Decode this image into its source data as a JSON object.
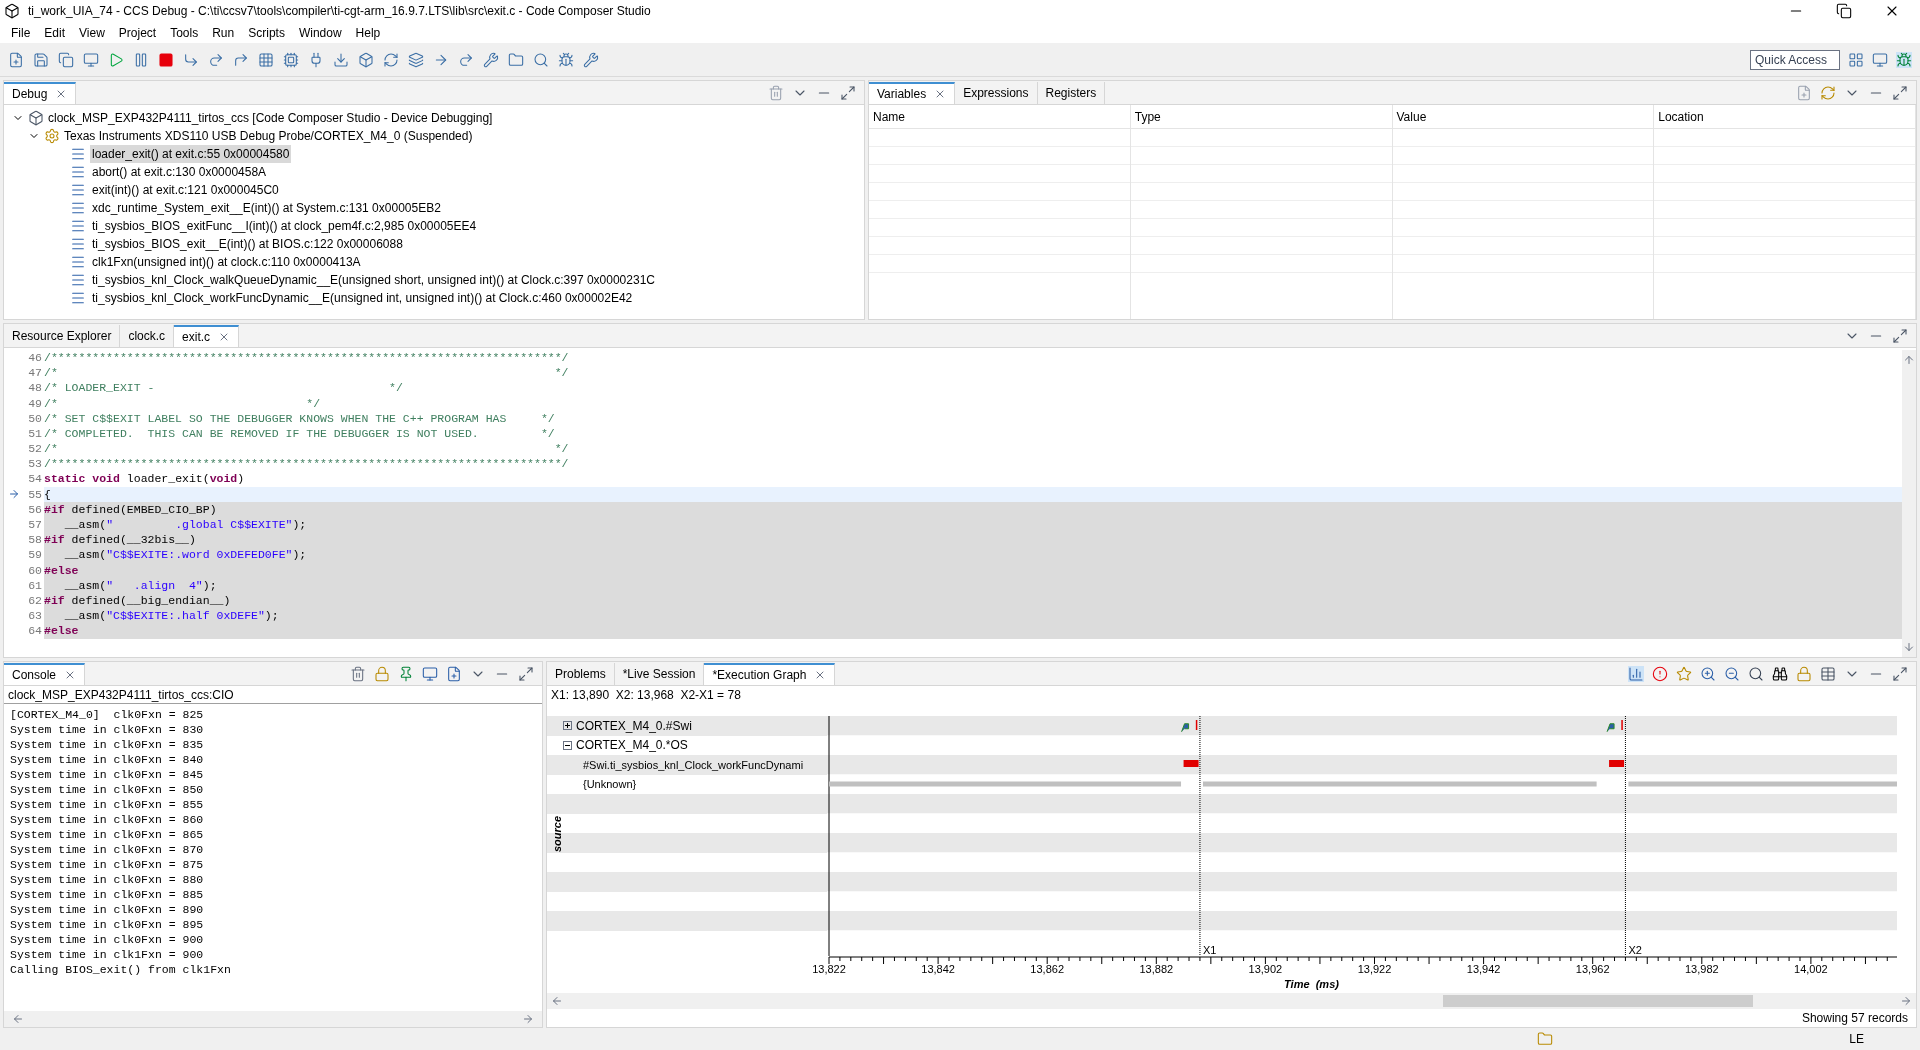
{
  "window": {
    "title": "ti_work_UIA_74 - CCS Debug - C:\\ti\\ccsv7\\tools\\compiler\\ti-cgt-arm_16.9.7.LTS\\lib\\src\\exit.c - Code Composer Studio"
  },
  "menu": [
    "File",
    "Edit",
    "View",
    "Project",
    "Tools",
    "Run",
    "Scripts",
    "Window",
    "Help"
  ],
  "quick_access": {
    "placeholder": "Quick Access"
  },
  "debug": {
    "tabs": [
      {
        "label": "Debug",
        "selected": true
      }
    ],
    "tree": [
      {
        "label": "clock_MSP_EXP432P4111_tirtos_ccs [Code Composer Studio - Device Debugging]",
        "expanded": true,
        "children": [
          {
            "label": "Texas Instruments XDS110 USB Debug Probe/CORTEX_M4_0 (Suspended)",
            "expanded": true,
            "frames": [
              {
                "label": "loader_exit() at exit.c:55 0x00004580",
                "selected": true
              },
              {
                "label": "abort() at exit.c:130 0x0000458A",
                "selected": false
              },
              {
                "label": "exit(int)() at exit.c:121 0x000045C0",
                "selected": false
              },
              {
                "label": "xdc_runtime_System_exit__E(int)() at System.c:131 0x00005EB2",
                "selected": false
              },
              {
                "label": "ti_sysbios_BIOS_exitFunc__I(int)() at clock_pem4f.c:2,985 0x00005EE4",
                "selected": false
              },
              {
                "label": "ti_sysbios_BIOS_exit__E(int)() at BIOS.c:122 0x00006088",
                "selected": false
              },
              {
                "label": "clk1Fxn(unsigned int)() at clock.c:110 0x0000413A",
                "selected": false
              },
              {
                "label": "ti_sysbios_knl_Clock_walkQueueDynamic__E(unsigned short, unsigned int)() at Clock.c:397 0x0000231C",
                "selected": false
              },
              {
                "label": "ti_sysbios_knl_Clock_workFuncDynamic__E(unsigned int, unsigned int)() at Clock.c:460 0x00002E42",
                "selected": false
              }
            ]
          }
        ]
      }
    ]
  },
  "variables": {
    "tabs": [
      {
        "label": "Variables",
        "selected": true
      },
      {
        "label": "Expressions",
        "selected": false
      },
      {
        "label": "Registers",
        "selected": false
      }
    ],
    "columns": [
      "Name",
      "Type",
      "Value",
      "Location"
    ]
  },
  "editor": {
    "tabs": [
      {
        "label": "Resource Explorer",
        "selected": false
      },
      {
        "label": "clock.c",
        "selected": false
      },
      {
        "label": "exit.c",
        "selected": true
      }
    ],
    "lines": [
      {
        "number": "46",
        "current": false,
        "inactive": false,
        "segments": [
          {
            "kind": "comment",
            "text": "/**************************************************************************/"
          }
        ]
      },
      {
        "number": "47",
        "current": false,
        "inactive": false,
        "segments": [
          {
            "kind": "comment",
            "text": "/*                                                                        */"
          }
        ]
      },
      {
        "number": "48",
        "current": false,
        "inactive": false,
        "segments": [
          {
            "kind": "comment",
            "text": "/* LOADER_EXIT -                                  */"
          }
        ]
      },
      {
        "number": "49",
        "current": false,
        "inactive": false,
        "segments": [
          {
            "kind": "comment",
            "text": "/*                                    */"
          }
        ]
      },
      {
        "number": "50",
        "current": false,
        "inactive": false,
        "segments": [
          {
            "kind": "comment",
            "text": "/* SET C$$EXIT LABEL SO THE DEBUGGER KNOWS WHEN THE C++ PROGRAM HAS     */"
          }
        ]
      },
      {
        "number": "51",
        "current": false,
        "inactive": false,
        "segments": [
          {
            "kind": "comment",
            "text": "/* COMPLETED.  THIS CAN BE REMOVED IF THE DEBUGGER IS NOT USED.         */"
          }
        ]
      },
      {
        "number": "52",
        "current": false,
        "inactive": false,
        "segments": [
          {
            "kind": "comment",
            "text": "/*                                                                        */"
          }
        ]
      },
      {
        "number": "53",
        "current": false,
        "inactive": false,
        "segments": [
          {
            "kind": "comment",
            "text": "/**************************************************************************/"
          }
        ]
      },
      {
        "number": "54",
        "current": false,
        "inactive": false,
        "segments": [
          {
            "kind": "keyword",
            "text": "static void"
          },
          {
            "kind": "plain",
            "text": " loader_exit("
          },
          {
            "kind": "keyword",
            "text": "void"
          },
          {
            "kind": "plain",
            "text": ")"
          }
        ]
      },
      {
        "number": "55",
        "current": true,
        "inactive": false,
        "segments": [
          {
            "kind": "plain",
            "text": "{"
          }
        ]
      },
      {
        "number": "56",
        "current": false,
        "inactive": true,
        "segments": [
          {
            "kind": "keyword",
            "text": "#if"
          },
          {
            "kind": "plain",
            "text": " defined(EMBED_CIO_BP)"
          }
        ]
      },
      {
        "number": "57",
        "current": false,
        "inactive": true,
        "segments": [
          {
            "kind": "plain",
            "text": "   __asm("
          },
          {
            "kind": "string",
            "text": "\"         .global C$$EXITE\""
          },
          {
            "kind": "plain",
            "text": ");"
          }
        ]
      },
      {
        "number": "58",
        "current": false,
        "inactive": true,
        "segments": [
          {
            "kind": "keyword",
            "text": "#if"
          },
          {
            "kind": "plain",
            "text": " defined(__32bis__)"
          }
        ]
      },
      {
        "number": "59",
        "current": false,
        "inactive": true,
        "segments": [
          {
            "kind": "plain",
            "text": "   __asm("
          },
          {
            "kind": "string",
            "text": "\"C$$EXITE:.word 0xDEFED0FE\""
          },
          {
            "kind": "plain",
            "text": ");"
          }
        ]
      },
      {
        "number": "60",
        "current": false,
        "inactive": true,
        "segments": [
          {
            "kind": "keyword",
            "text": "#else"
          }
        ]
      },
      {
        "number": "61",
        "current": false,
        "inactive": true,
        "segments": [
          {
            "kind": "plain",
            "text": "   __asm("
          },
          {
            "kind": "string",
            "text": "\"   .align  4\""
          },
          {
            "kind": "plain",
            "text": ");"
          }
        ]
      },
      {
        "number": "62",
        "current": false,
        "inactive": true,
        "segments": [
          {
            "kind": "keyword",
            "text": "#if"
          },
          {
            "kind": "plain",
            "text": " defined(__big_endian__)"
          }
        ]
      },
      {
        "number": "63",
        "current": false,
        "inactive": true,
        "segments": [
          {
            "kind": "plain",
            "text": "   __asm("
          },
          {
            "kind": "string",
            "text": "\"C$$EXITE:.half 0xDEFE\""
          },
          {
            "kind": "plain",
            "text": ");"
          }
        ]
      },
      {
        "number": "64",
        "current": false,
        "inactive": true,
        "segments": [
          {
            "kind": "keyword",
            "text": "#else"
          }
        ]
      }
    ]
  },
  "console": {
    "tabs": [
      {
        "label": "Console",
        "selected": true
      }
    ],
    "name": "clock_MSP_EXP432P4111_tirtos_ccs:CIO",
    "lines": [
      "[CORTEX_M4_0]  clk0Fxn = 825",
      "System time in clk0Fxn = 830",
      "System time in clk0Fxn = 835",
      "System time in clk0Fxn = 840",
      "System time in clk0Fxn = 845",
      "System time in clk0Fxn = 850",
      "System time in clk0Fxn = 855",
      "System time in clk0Fxn = 860",
      "System time in clk0Fxn = 865",
      "System time in clk0Fxn = 870",
      "System time in clk0Fxn = 875",
      "System time in clk0Fxn = 880",
      "System time in clk0Fxn = 885",
      "System time in clk0Fxn = 890",
      "System time in clk0Fxn = 895",
      "System time in clk0Fxn = 900",
      "System time in clk1Fxn = 900",
      "Calling BIOS_exit() from clk1Fxn"
    ]
  },
  "graph": {
    "tabs": [
      {
        "label": "Problems",
        "selected": false
      },
      {
        "label": "*Live Session",
        "selected": false
      },
      {
        "label": "*Execution Graph",
        "selected": true
      }
    ],
    "cursor_info": "X1: 13,890  X2: 13,968  X2-X1 = 78",
    "rows": [
      {
        "label": "CORTEX_M4_0.#Swi",
        "expanded": false,
        "children": []
      },
      {
        "label": "CORTEX_M4_0.*OS",
        "expanded": true,
        "children": [
          {
            "label": "#Swi.ti_sysbios_knl_Clock_workFuncDynami"
          },
          {
            "label": "{Unknown}"
          }
        ]
      }
    ],
    "y_label": "source",
    "cursors": [
      "X1",
      "X2"
    ],
    "ticks": [
      "13,822",
      "13,842",
      "13,862",
      "13,882",
      "13,902",
      "13,922",
      "13,942",
      "13,962",
      "13,982",
      "14,002"
    ],
    "x_title": "Time  (ms)",
    "status": "Showing 57 records"
  },
  "status_bar": {
    "mode": "LE"
  }
}
